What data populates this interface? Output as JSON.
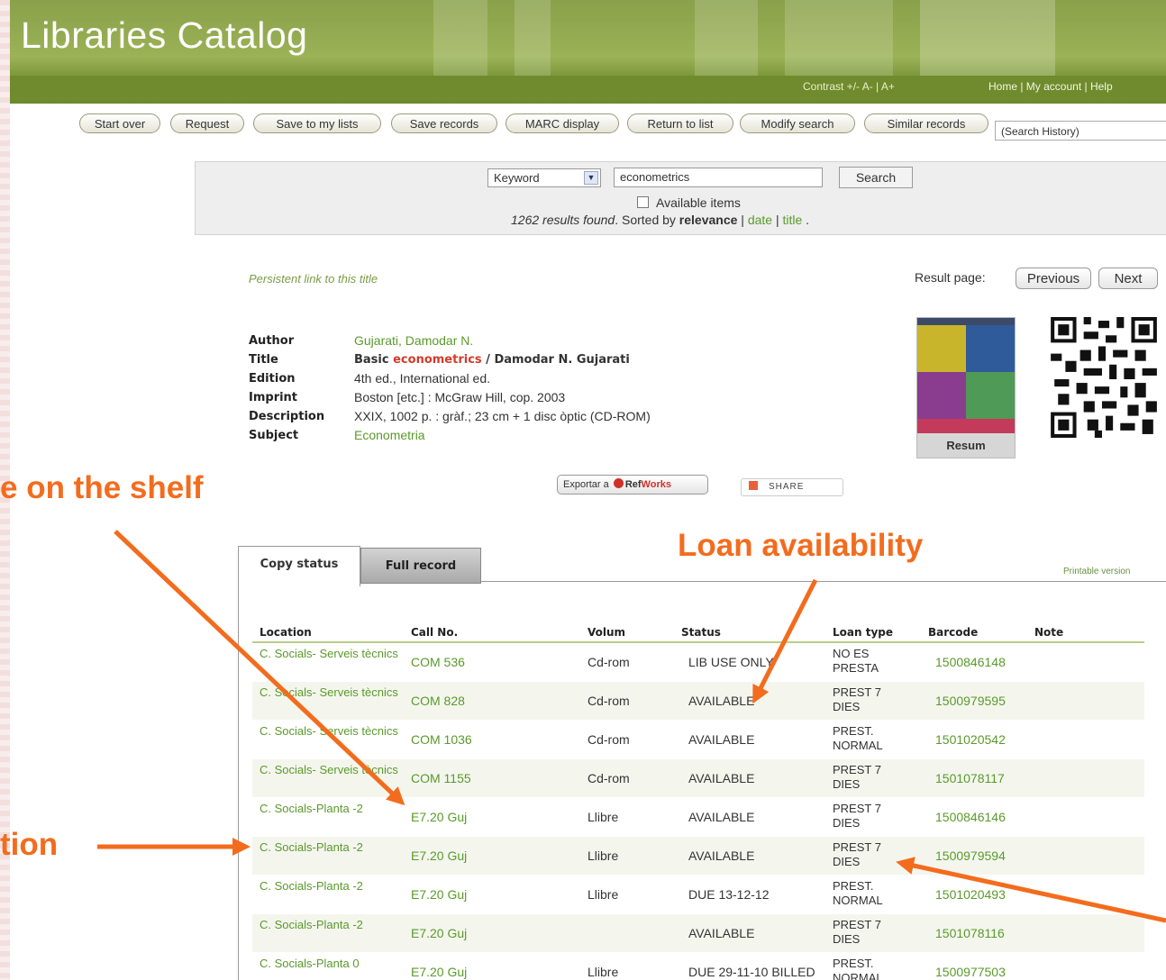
{
  "banner": {
    "title": "Libraries Catalog",
    "contrast": "Contrast +/-   A- | A+",
    "toplinks": "Home | My account | Help"
  },
  "toolbar": {
    "buttons": [
      "Start over",
      "Request",
      "Save to my lists",
      "Save records",
      "MARC display",
      "Return to list",
      "Modify search",
      "Similar records"
    ],
    "history_select": "(Search History)"
  },
  "search": {
    "field_type": "Keyword",
    "query": "econometrics",
    "search_button": "Search",
    "available_items": "Available items",
    "results_count": "1262 results found",
    "sorted_by": ". Sorted by ",
    "sort_relevance": "relevance",
    "sort_sep1": " | ",
    "sort_date": "date",
    "sort_sep2": " | ",
    "sort_title": "title",
    "sort_end": " ."
  },
  "record": {
    "persistent_link": "Persistent link to this title",
    "result_page_label": "Result page:",
    "previous": "Previous",
    "next": "Next",
    "fields": {
      "author_label": "Author",
      "author": "Gujarati, Damodar N.",
      "title_label": "Title",
      "title_basic": "Basic ",
      "title_hl": "econometrics",
      "title_rest": " / Damodar N. Gujarati",
      "edition_label": "Edition",
      "edition": "4th ed., International ed.",
      "imprint_label": "Imprint",
      "imprint": "Boston [etc.] : McGraw Hill, cop. 2003",
      "description_label": "Description",
      "description": "XXIX, 1002 p. : gràf.; 23 cm + 1 disc òptic (CD-ROM)",
      "subject_label": "Subject",
      "subject": "Econometria"
    },
    "cover_caption": "Resum",
    "export_label": "Exportar a",
    "export_brand_a": "Ref",
    "export_brand_b": "Works",
    "share": "SHARE"
  },
  "tabs": {
    "copy_status": "Copy status",
    "full_record": "Full record",
    "printable": "Printable version"
  },
  "table": {
    "headers": [
      "Location",
      "Call No.",
      "Volum",
      "Status",
      "Loan type",
      "Barcode",
      "Note"
    ],
    "rows": [
      {
        "location": "C. Socials- Serveis tècnics",
        "call": "COM 536",
        "volum": "Cd-rom",
        "status": "LIB USE ONLY",
        "loan": "NO ES PRESTA",
        "barcode": "1500846148"
      },
      {
        "location": "C. Socials- Serveis tècnics",
        "call": "COM 828",
        "volum": "Cd-rom",
        "status": "AVAILABLE",
        "loan": "PREST 7 DIES",
        "barcode": "1500979595"
      },
      {
        "location": "C. Socials- Serveis tècnics",
        "call": "COM 1036",
        "volum": "Cd-rom",
        "status": "AVAILABLE",
        "loan": "PREST. NORMAL",
        "barcode": "1501020542"
      },
      {
        "location": "C. Socials- Serveis tècnics",
        "call": "COM 1155",
        "volum": "Cd-rom",
        "status": "AVAILABLE",
        "loan": "PREST 7 DIES",
        "barcode": "1501078117"
      },
      {
        "location": "C. Socials-Planta -2",
        "call": "E7.20 Guj",
        "volum": "Llibre",
        "status": "AVAILABLE",
        "loan": "PREST 7 DIES",
        "barcode": "1500846146"
      },
      {
        "location": "C. Socials-Planta -2",
        "call": "E7.20 Guj",
        "volum": "Llibre",
        "status": "AVAILABLE",
        "loan": "PREST 7 DIES",
        "barcode": "1500979594"
      },
      {
        "location": "C. Socials-Planta -2",
        "call": "E7.20 Guj",
        "volum": "Llibre",
        "status": "DUE 13-12-12",
        "loan": "PREST. NORMAL",
        "barcode": "1501020493"
      },
      {
        "location": "C. Socials-Planta -2",
        "call": "E7.20 Guj",
        "volum": "",
        "status": "AVAILABLE",
        "loan": "PREST 7 DIES",
        "barcode": "1501078116"
      },
      {
        "location": "C. Socials-Planta 0",
        "call": "E7.20 Guj",
        "volum": "Llibre",
        "status": "DUE 29-11-10 BILLED",
        "loan": "PREST. NORMAL",
        "barcode": "1500977503"
      }
    ]
  },
  "annotations": {
    "shelf": "e on the shelf",
    "loan": "Loan availability",
    "location": "tion"
  },
  "colors": {
    "accent_green": "#5a9a2a",
    "annotation_orange": "#f36c1d",
    "banner_green": "#8aa04a"
  }
}
